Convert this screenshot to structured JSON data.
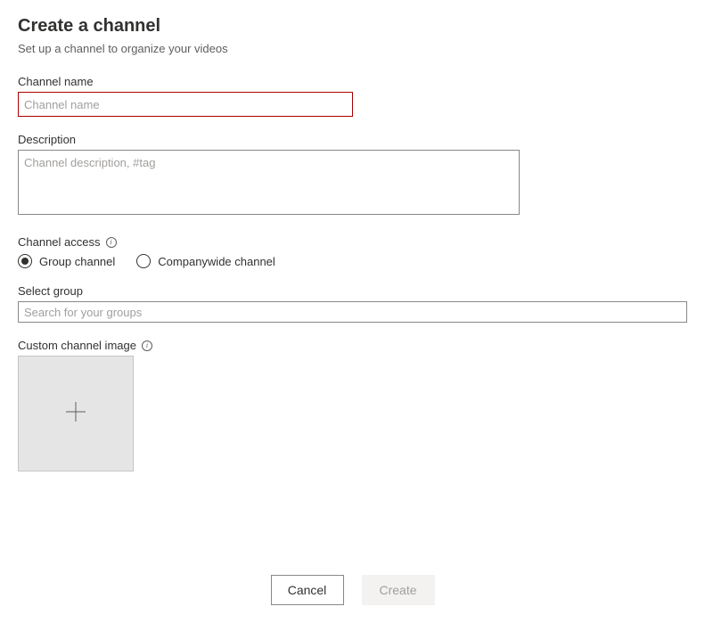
{
  "header": {
    "title": "Create a channel",
    "subtitle": "Set up a channel to organize your videos"
  },
  "fields": {
    "channel_name": {
      "label": "Channel name",
      "placeholder": "Channel name",
      "value": ""
    },
    "description": {
      "label": "Description",
      "placeholder": "Channel description, #tag",
      "value": ""
    },
    "channel_access": {
      "label": "Channel access",
      "options": {
        "group": "Group channel",
        "companywide": "Companywide channel"
      },
      "selected": "group"
    },
    "select_group": {
      "label": "Select group",
      "placeholder": "Search for your groups",
      "value": ""
    },
    "custom_image": {
      "label": "Custom channel image"
    }
  },
  "buttons": {
    "cancel": "Cancel",
    "create": "Create"
  }
}
